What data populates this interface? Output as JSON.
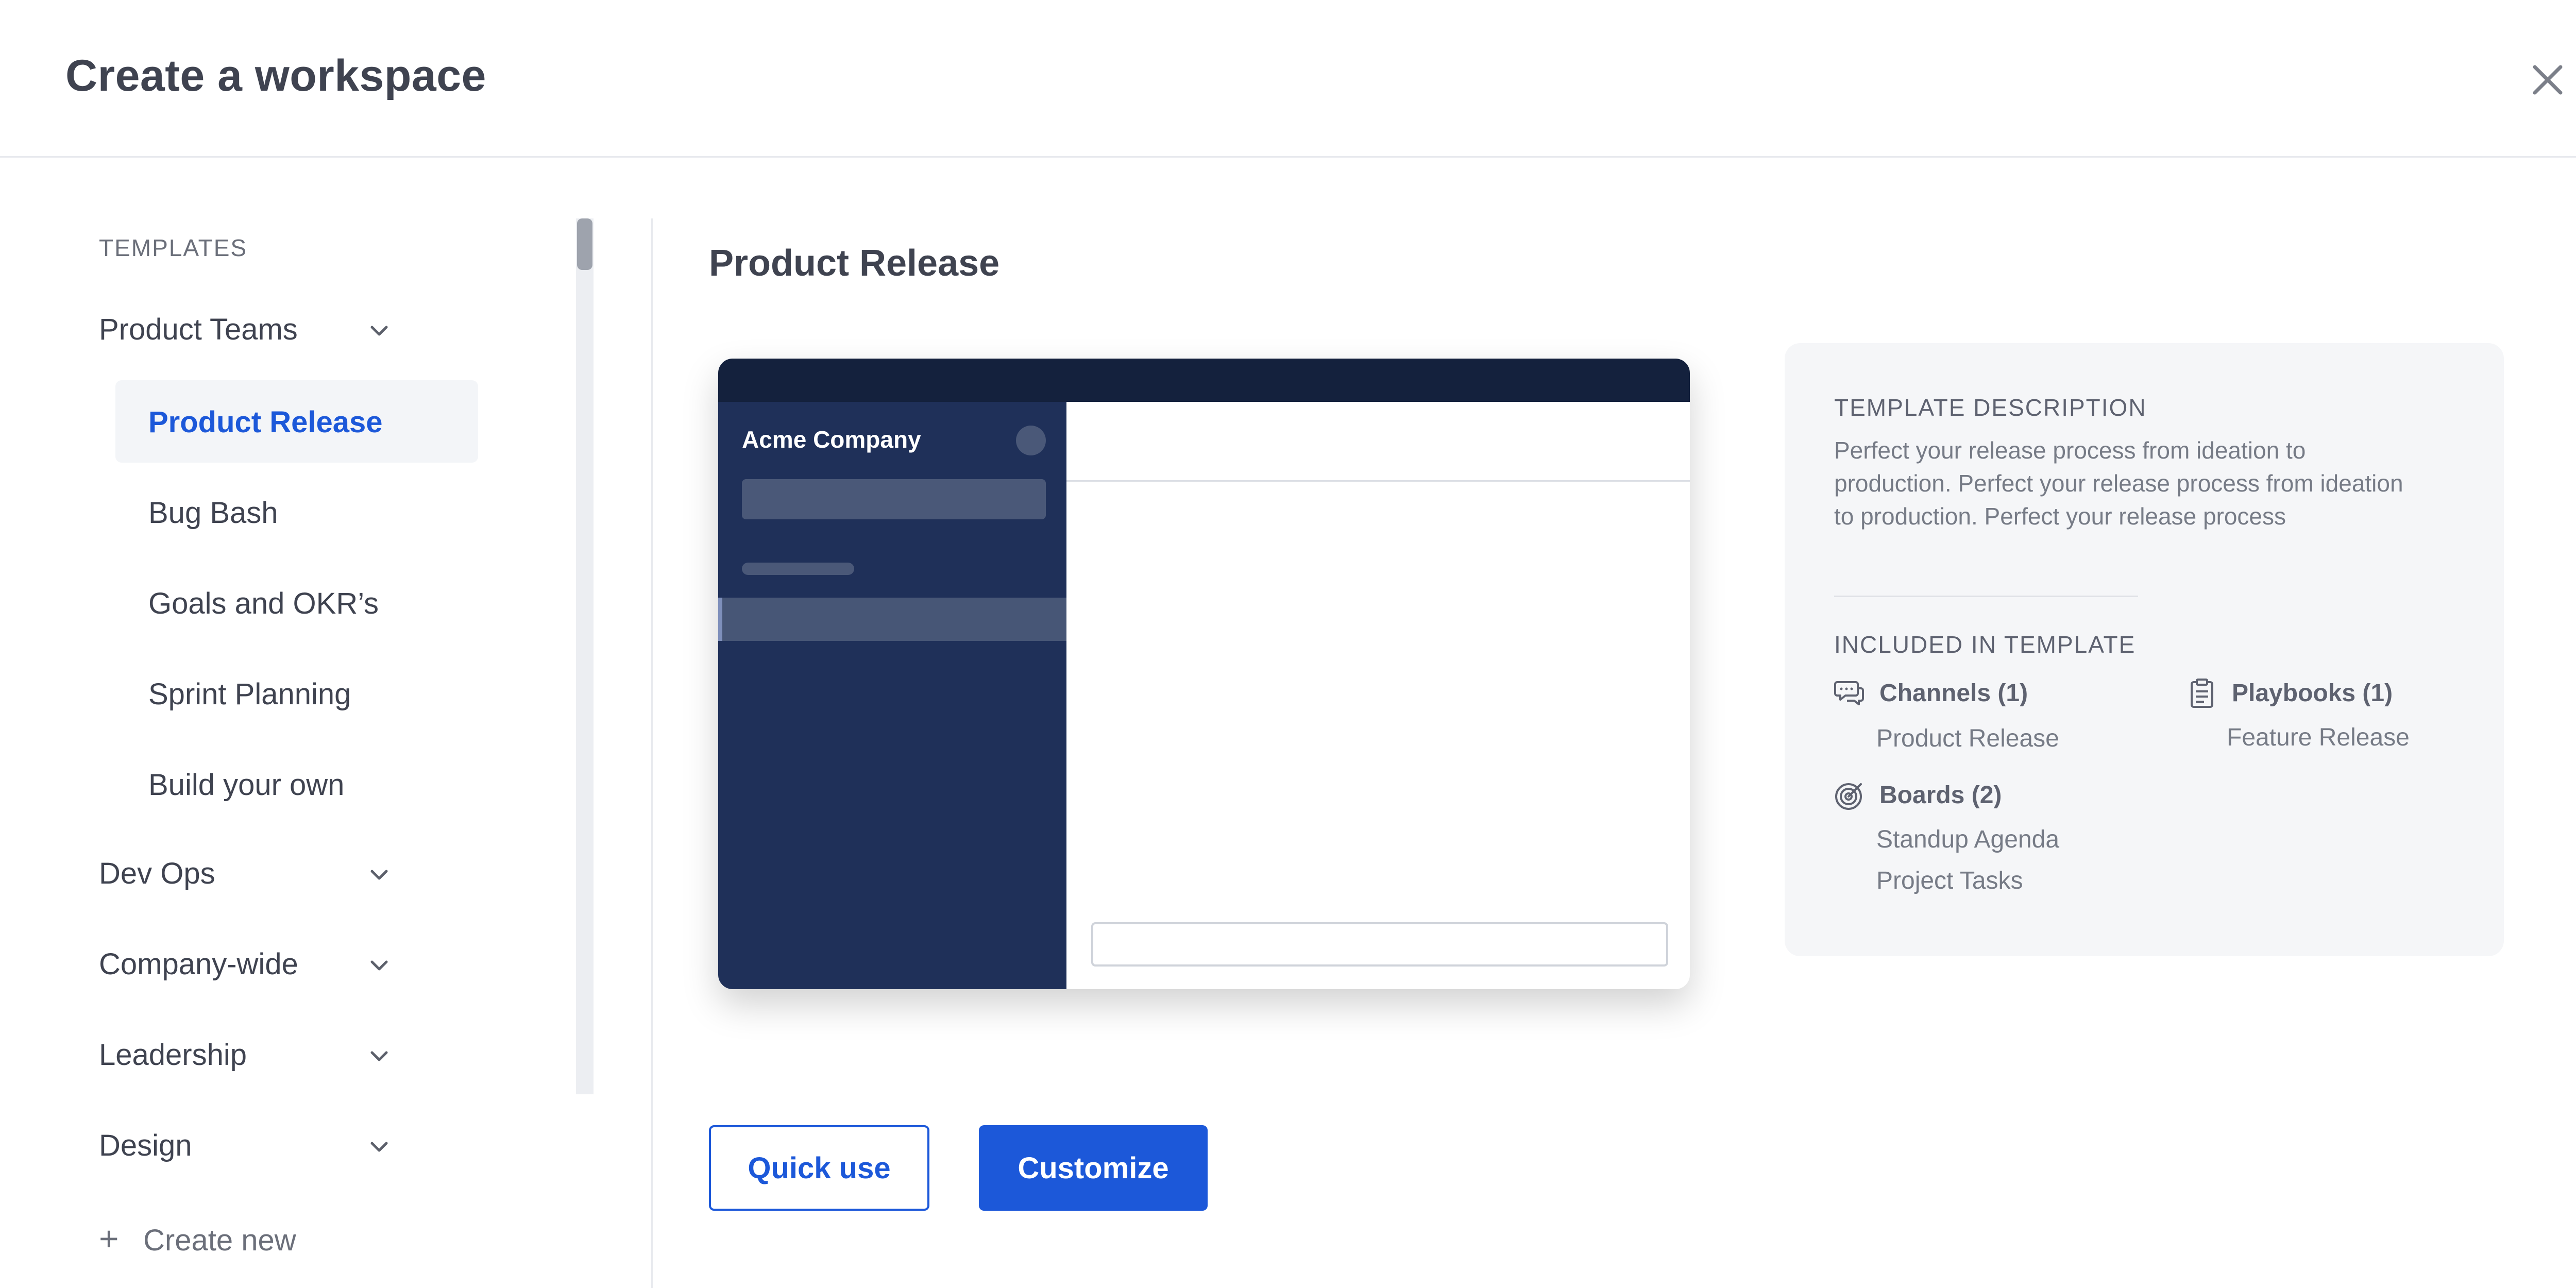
{
  "modal": {
    "title": "Create a workspace",
    "close_icon": "close-icon"
  },
  "sidebar": {
    "section_label": "TEMPLATES",
    "groups": [
      {
        "label": "Product Teams",
        "expanded": true
      },
      {
        "label": "Dev Ops",
        "expanded": false
      },
      {
        "label": "Company-wide",
        "expanded": false
      },
      {
        "label": "Leadership",
        "expanded": false
      },
      {
        "label": "Design",
        "expanded": false
      }
    ],
    "items": [
      {
        "label": "Product Release",
        "selected": true
      },
      {
        "label": "Bug Bash",
        "selected": false
      },
      {
        "label": "Goals and OKR’s",
        "selected": false
      },
      {
        "label": "Sprint Planning",
        "selected": false
      },
      {
        "label": "Build your own",
        "selected": false
      }
    ],
    "create_new": "Create new"
  },
  "main": {
    "title": "Product Release",
    "preview": {
      "company": "Acme Company"
    },
    "description": {
      "label": "TEMPLATE DESCRIPTION",
      "text": "Perfect your release process from ideation to production. Perfect your release process from ideation to production. Perfect your release process"
    },
    "included": {
      "label": "INCLUDED IN TEMPLATE",
      "channels": {
        "title": "Channels (1)",
        "icon": "chat-bubbles-icon",
        "entries": [
          "Product Release"
        ]
      },
      "playbooks": {
        "title": "Playbooks (1)",
        "icon": "clipboard-icon",
        "entries": [
          "Feature Release"
        ]
      },
      "boards": {
        "title": "Boards (2)",
        "icon": "target-icon",
        "entries": [
          "Standup Agenda",
          "Project Tasks"
        ]
      }
    },
    "buttons": {
      "quick_use": "Quick use",
      "customize": "Customize"
    }
  },
  "colors": {
    "accent": "#1c58d9",
    "preview_sidebar": "#1f3059",
    "preview_topbar": "#14213d",
    "card_bg": "#f5f6f8"
  }
}
